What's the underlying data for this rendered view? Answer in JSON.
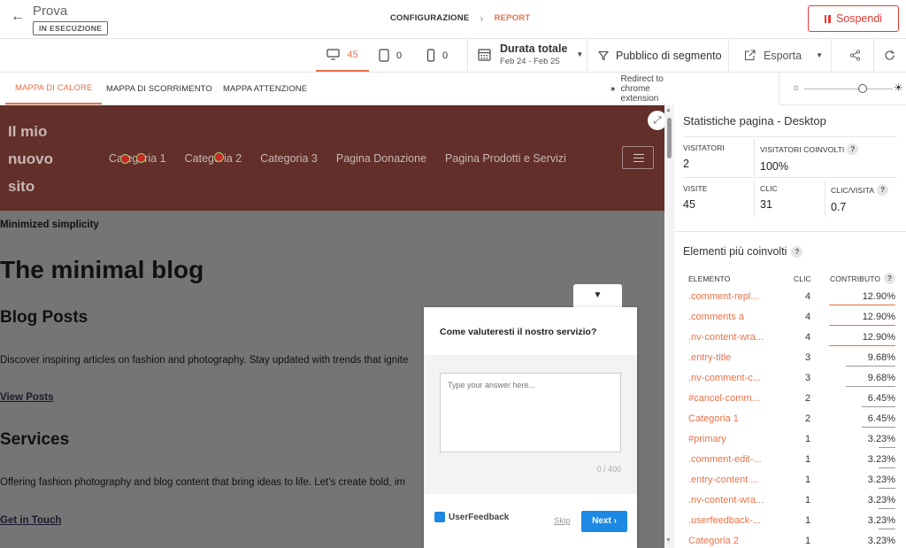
{
  "header": {
    "back_icon": "arrow-left-icon",
    "title": "Prova",
    "status_badge": "IN ESECUZIONE",
    "steps": [
      "CONFIGURAZIONE",
      "REPORT"
    ],
    "stop_label": "Sospendi"
  },
  "toolbar": {
    "desktop_count": "45",
    "tablet_count": "0",
    "mobile_count": "0",
    "duration_label": "Durata totale",
    "duration_range": "Feb 24 - Feb 25",
    "segment_label": "Pubblico di segmento",
    "export_label": "Esporta"
  },
  "tabs": {
    "heatmap": "MAPPA DI CALORE",
    "scroll": "MAPPA DI SCORRIMENTO",
    "attention": "MAPPA ATTENZIONE",
    "redirect": "Redirect to chrome extension"
  },
  "site": {
    "title_lines": [
      "Il mio",
      "nuovo",
      "sito"
    ],
    "nav": [
      "Categoria 1",
      "Categoria 2",
      "Categoria 3",
      "Pagina Donazione",
      "Pagina Prodotti e Servizi"
    ],
    "tagline": "Minimized simplicity",
    "heading": "The minimal blog",
    "section1_title": "Blog Posts",
    "section1_text": "Discover inspiring articles on fashion and photography. Stay updated with trends that ignite",
    "section1_link": "View Posts",
    "section2_title": "Services",
    "section2_text": "Offering fashion photography and blog content that bring ideas to life. Let’s create bold, im",
    "section2_link": "Get in Touch"
  },
  "survey": {
    "question": "Come valuteresti il nostro servizio?",
    "placeholder": "Type your answer here...",
    "counter": "0 / 400",
    "brand": "UserFeedback",
    "skip": "Skip",
    "next": "Next"
  },
  "panel": {
    "title": "Statistiche pagina - Desktop",
    "stats": {
      "visitors_label": "VISITATORI",
      "visitors": "2",
      "engaged_label": "VISITATORI COINVOLTI",
      "engaged": "100%",
      "visits_label": "VISITE",
      "visits": "45",
      "clicks_label": "CLIC",
      "clicks": "31",
      "cpv_label": "CLIC/VISITA",
      "cpv": "0.7"
    },
    "elements_title": "Elementi più coinvolti",
    "columns": {
      "element": "ELEMENTO",
      "clicks": "CLIC",
      "contribution": "CONTRIBUTO"
    },
    "rows": [
      {
        "name": ".comment-repl...",
        "clicks": "4",
        "contribution": "12.90%",
        "pct": 12.9
      },
      {
        "name": ".comments a",
        "clicks": "4",
        "contribution": "12.90%",
        "pct": 12.9
      },
      {
        "name": ".nv-content-wra...",
        "clicks": "4",
        "contribution": "12.90%",
        "pct": 12.9
      },
      {
        "name": ".entry-title",
        "clicks": "3",
        "contribution": "9.68%",
        "pct": 9.68
      },
      {
        "name": ".nv-comment-c...",
        "clicks": "3",
        "contribution": "9.68%",
        "pct": 9.68
      },
      {
        "name": "#cancel-comm...",
        "clicks": "2",
        "contribution": "6.45%",
        "pct": 6.45
      },
      {
        "name": "Categoria 1",
        "clicks": "2",
        "contribution": "6.45%",
        "pct": 6.45
      },
      {
        "name": "#primary",
        "clicks": "1",
        "contribution": "3.23%",
        "pct": 3.23
      },
      {
        "name": ".comment-edit-...",
        "clicks": "1",
        "contribution": "3.23%",
        "pct": 3.23
      },
      {
        "name": ".entry-content ...",
        "clicks": "1",
        "contribution": "3.23%",
        "pct": 3.23
      },
      {
        "name": ".nv-content-wra...",
        "clicks": "1",
        "contribution": "3.23%",
        "pct": 3.23
      },
      {
        "name": ".userfeedback-...",
        "clicks": "1",
        "contribution": "3.23%",
        "pct": 3.23
      },
      {
        "name": "Categoria 2",
        "clicks": "1",
        "contribution": "3.23%",
        "pct": 3.23
      }
    ]
  },
  "colors": {
    "accent": "#e8724a",
    "danger": "#e53935",
    "site_header": "#622f2b",
    "overlay": "#757575",
    "bar_high": "#e8724a",
    "bar_low": "#999999"
  }
}
